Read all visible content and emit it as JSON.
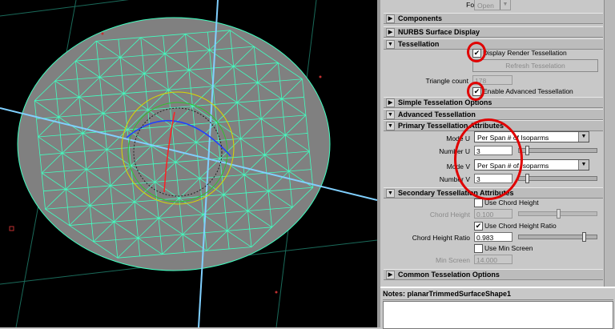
{
  "attribute_editor": {
    "form_v": {
      "label": "Form V",
      "value": "Open"
    },
    "sections": {
      "components": "Components",
      "nurbs_display": "NURBS Surface Display",
      "tessellation": "Tessellation",
      "simple_tess": "Simple Tesselation Options",
      "advanced_tess": "Advanced Tessellation",
      "primary_attrs": "Primary Tessellation Attributes",
      "secondary_attrs": "Secondary Tessellation Attributes",
      "common_tess": "Common Tesselation Options"
    },
    "display_render_tess": {
      "label": "Display Render Tessellation",
      "checked": "✔"
    },
    "refresh_button": "Refresh Tesselation",
    "triangle_count": {
      "label": "Triangle count",
      "value": "178"
    },
    "enable_advanced": {
      "label": "Enable Advanced Tessellation",
      "checked": "✔"
    },
    "mode_u": {
      "label": "Mode U",
      "value": "Per Span # of Isoparms"
    },
    "number_u": {
      "label": "Number U",
      "value": "3"
    },
    "mode_v": {
      "label": "Mode V",
      "value": "Per Span # of Isoparms"
    },
    "number_v": {
      "label": "Number V",
      "value": "3"
    },
    "use_chord_height": {
      "label": "Use Chord Height",
      "checked": ""
    },
    "chord_height": {
      "label": "Chord Height",
      "value": "0.100"
    },
    "use_chord_height_ratio": {
      "label": "Use Chord Height Ratio",
      "checked": "✔"
    },
    "chord_height_ratio": {
      "label": "Chord Height Ratio",
      "value": "0.983"
    },
    "use_min_screen": {
      "label": "Use Min Screen",
      "checked": ""
    },
    "min_screen": {
      "label": "Min Screen",
      "value": "14.000"
    }
  },
  "notes": {
    "title": "Notes: planarTrimmedSurfaceShape1"
  },
  "colors": {
    "viewport_bg": "#000000",
    "surface": "#808080",
    "wire": "#40ffc0",
    "highlight": "#e00000"
  }
}
